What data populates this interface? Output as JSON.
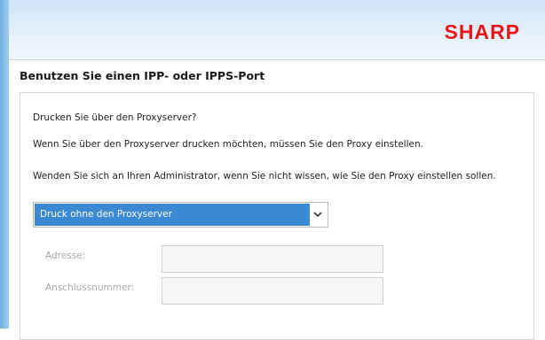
{
  "brand": {
    "logo_text": "SHARP",
    "logo_color": "#e8161b"
  },
  "page": {
    "title": "Benutzen Sie einen IPP- oder IPPS-Port"
  },
  "content": {
    "question": "Drucken Sie über den Proxyserver?",
    "info_line1": "Wenn Sie über den Proxyserver drucken möchten, müssen Sie den Proxy einstellen.",
    "info_line2": "Wenden Sie sich an Ihren Administrator, wenn Sie nicht wissen, wie Sie den Proxy einstellen sollen."
  },
  "proxy_select": {
    "selected": "Druck ohne den Proxyserver",
    "highlight_color": "#3b88d3",
    "icon": "chevron-down-icon"
  },
  "fields": {
    "address_label": "Adresse:",
    "port_label": "Anschlussnummer:",
    "address_value": "",
    "port_value": "",
    "enabled": false
  }
}
